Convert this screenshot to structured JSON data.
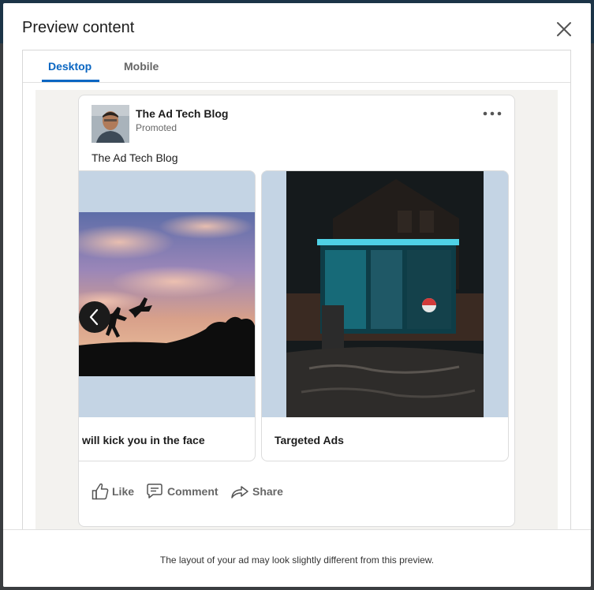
{
  "modal": {
    "title": "Preview content",
    "footer_note": "The layout of your ad may look slightly different from this preview."
  },
  "tabs": [
    {
      "label": "Desktop",
      "active": true
    },
    {
      "label": "Mobile",
      "active": false
    }
  ],
  "post": {
    "author": "The Ad Tech Blog",
    "subtitle": "Promoted",
    "intro_text": "The Ad Tech Blog",
    "slides": [
      {
        "caption": "will kick you in the face"
      },
      {
        "caption": "Targeted Ads"
      }
    ],
    "actions": {
      "like": "Like",
      "comment": "Comment",
      "share": "Share"
    }
  },
  "colors": {
    "accent": "#0a66c2",
    "muted_text": "#666666",
    "stage_bg": "#f3f2ef"
  },
  "icons": [
    "close-icon",
    "more-icon",
    "chevron-left-icon",
    "like-icon",
    "comment-icon",
    "share-icon"
  ]
}
